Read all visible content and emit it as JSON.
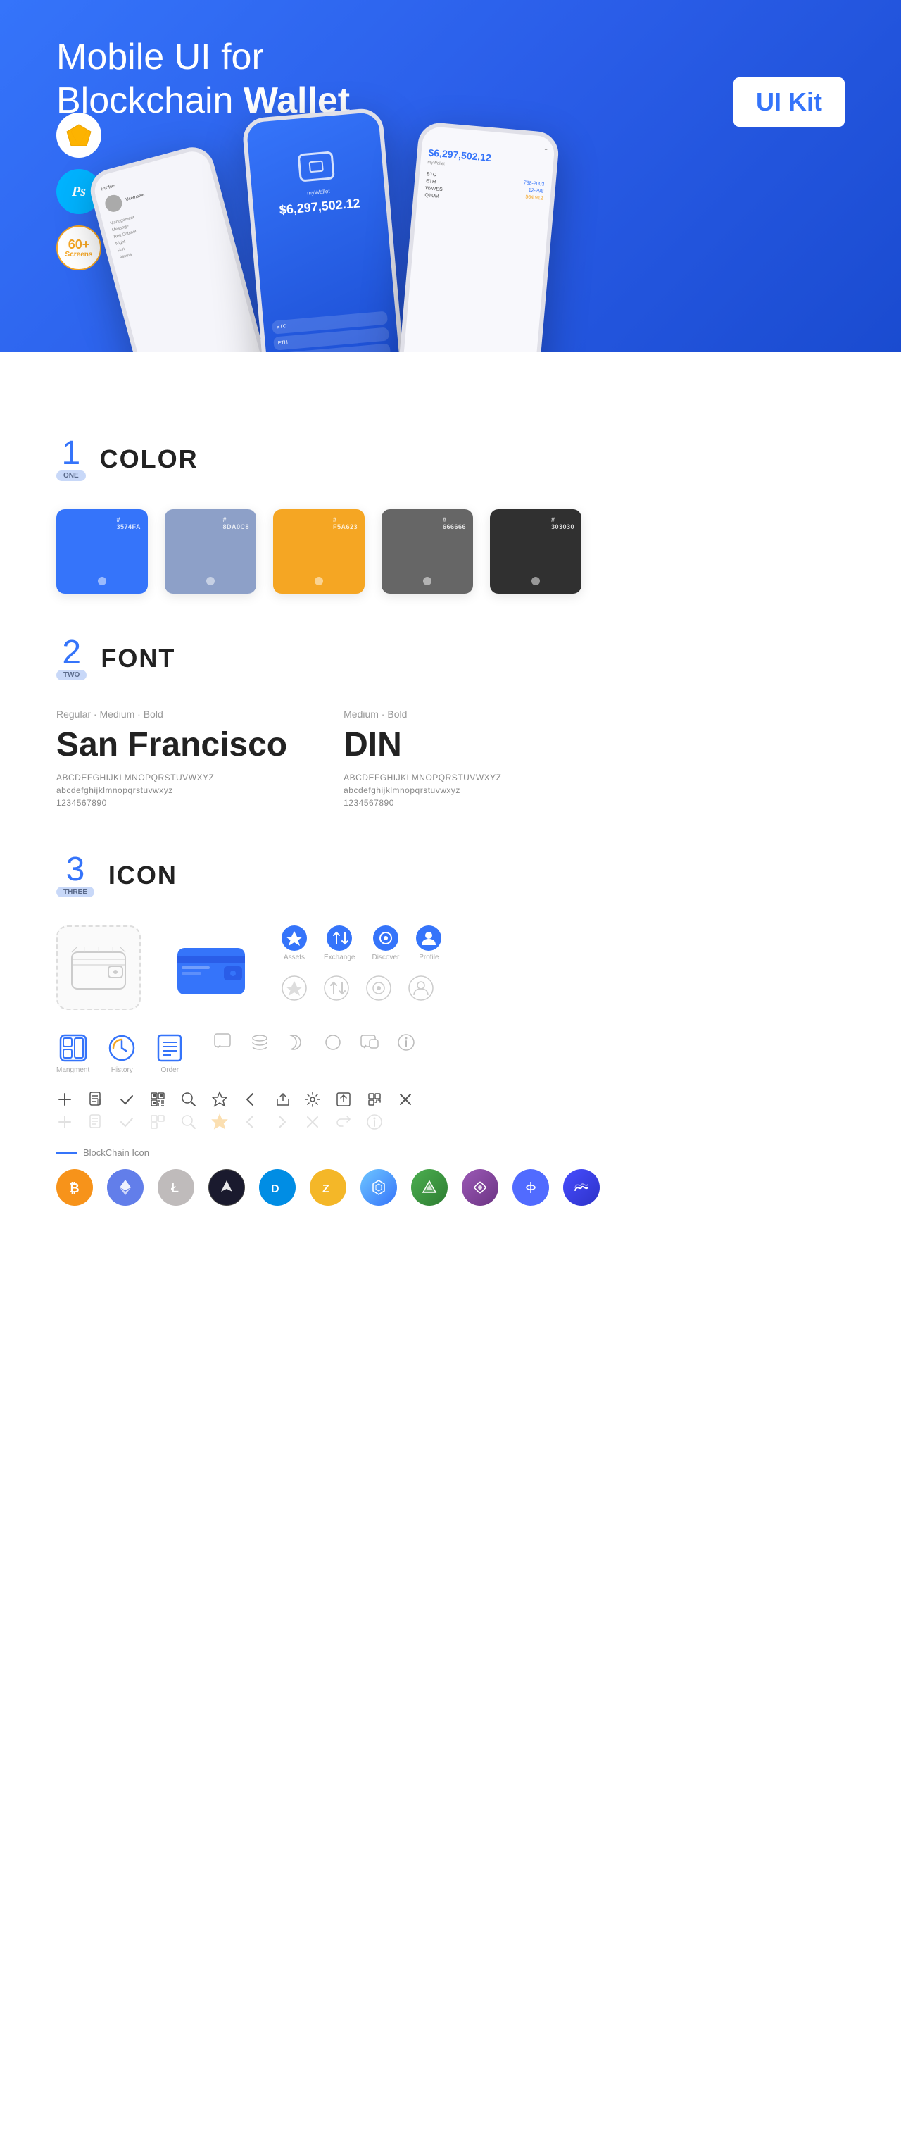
{
  "hero": {
    "title_regular": "Mobile UI for Blockchain ",
    "title_bold": "Wallet",
    "ui_kit_label": "UI Kit",
    "badge_ps": "Ps",
    "badge_screens": "60+\nScreens"
  },
  "sections": {
    "color": {
      "num": "1",
      "num_label": "ONE",
      "title": "COLOR",
      "swatches": [
        {
          "hex": "#3574FA",
          "label": "#\n3574FA",
          "id": "blue"
        },
        {
          "hex": "#8DA0C8",
          "label": "#\n8DA0C8",
          "id": "slate"
        },
        {
          "hex": "#F5A623",
          "label": "#\nF5A623",
          "id": "orange"
        },
        {
          "hex": "#666666",
          "label": "#\n666666",
          "id": "gray"
        },
        {
          "hex": "#303030",
          "label": "#\n303030",
          "id": "dark"
        }
      ]
    },
    "font": {
      "num": "2",
      "num_label": "TWO",
      "title": "FONT",
      "fonts": [
        {
          "weights": "Regular · Medium · Bold",
          "name": "San Francisco",
          "uppercase": "ABCDEFGHIJKLMNOPQRSTUVWXYZ",
          "lowercase": "abcdefghijklmnopqrstuvwxyz",
          "numbers": "1234567890"
        },
        {
          "weights": "Medium · Bold",
          "name": "DIN",
          "uppercase": "ABCDEFGHIJKLMNOPQRSTUVWXYZ",
          "lowercase": "abcdefghijklmnopqrstuvwxyz",
          "numbers": "1234567890"
        }
      ]
    },
    "icon": {
      "num": "3",
      "num_label": "THREE",
      "title": "ICON",
      "nav_icons": [
        {
          "label": "Assets",
          "id": "assets"
        },
        {
          "label": "Exchange",
          "id": "exchange"
        },
        {
          "label": "Discover",
          "id": "discover"
        },
        {
          "label": "Profile",
          "id": "profile"
        }
      ],
      "bottom_nav_icons": [
        {
          "label": "Mangment",
          "id": "management"
        },
        {
          "label": "History",
          "id": "history"
        },
        {
          "label": "Order",
          "id": "order"
        }
      ],
      "blockchain_label": "BlockChain Icon",
      "crypto_icons": [
        {
          "symbol": "₿",
          "name": "Bitcoin",
          "class": "ci-btc"
        },
        {
          "symbol": "Ξ",
          "name": "Ethereum",
          "class": "ci-eth"
        },
        {
          "symbol": "Ł",
          "name": "Litecoin",
          "class": "ci-ltc"
        },
        {
          "symbol": "◆",
          "name": "Wing",
          "class": "ci-wing"
        },
        {
          "symbol": "D",
          "name": "Dash",
          "class": "ci-dash"
        },
        {
          "symbol": "Z",
          "name": "Zcash",
          "class": "ci-zcash"
        },
        {
          "symbol": "⬡",
          "name": "Grid",
          "class": "ci-grid"
        },
        {
          "symbol": "△",
          "name": "Safe",
          "class": "ci-safe"
        },
        {
          "symbol": "◈",
          "name": "Prism",
          "class": "ci-prism"
        },
        {
          "symbol": "◈",
          "name": "Band",
          "class": "ci-band"
        },
        {
          "symbol": "~",
          "name": "Helium",
          "class": "ci-helium"
        }
      ]
    }
  }
}
